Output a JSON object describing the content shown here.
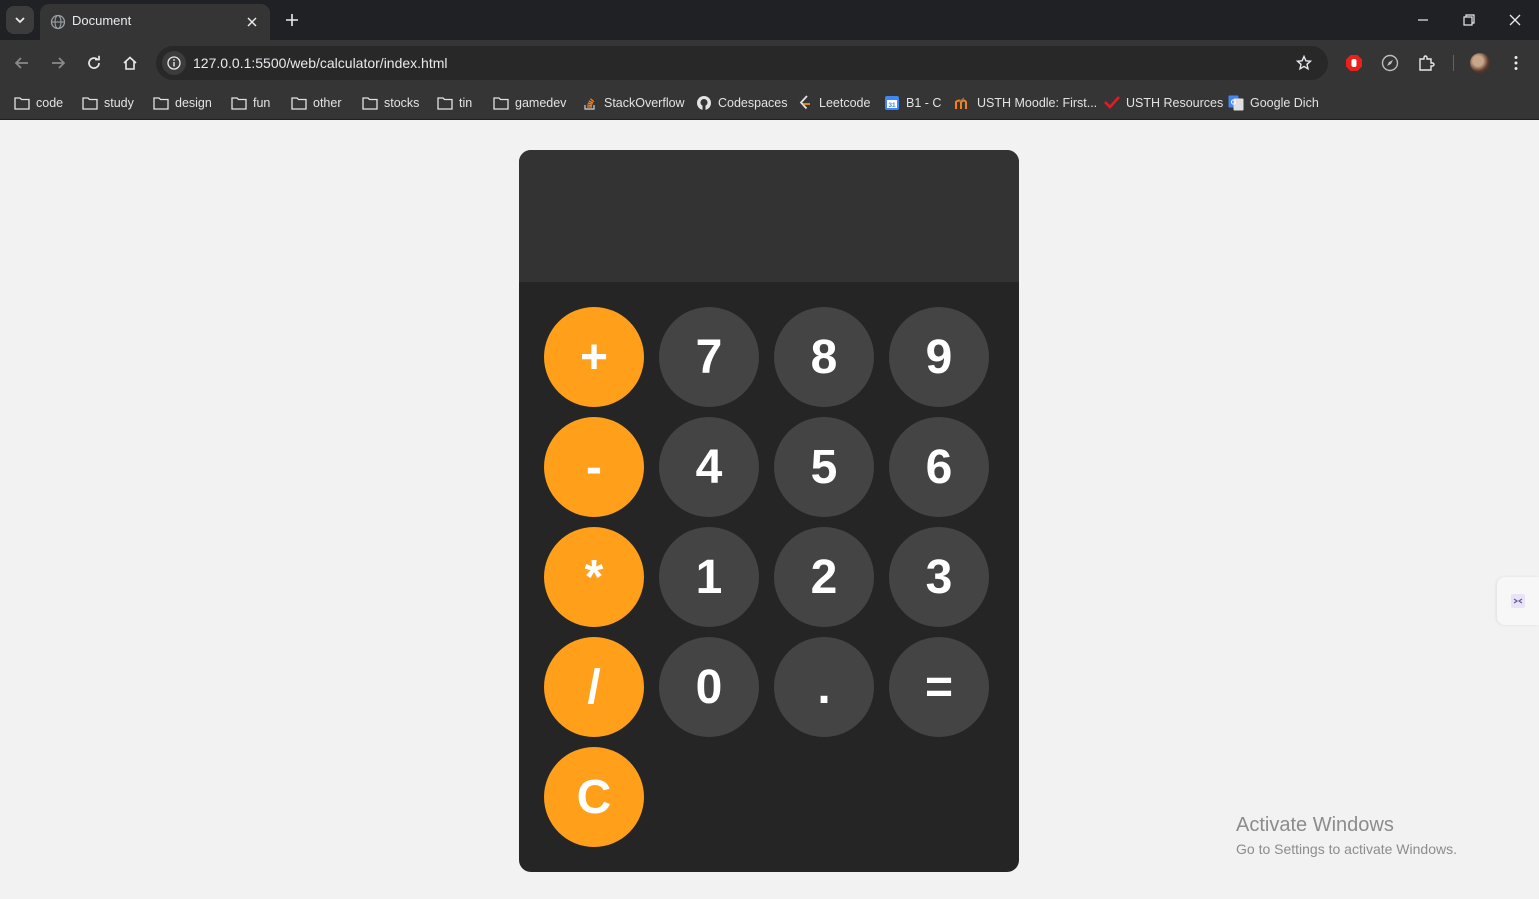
{
  "browser": {
    "tab_title": "Document",
    "url": "127.0.0.1:5500/web/calculator/index.html",
    "bookmarks": [
      {
        "label": "code",
        "icon": "folder-icon"
      },
      {
        "label": "study",
        "icon": "folder-icon"
      },
      {
        "label": "design",
        "icon": "folder-icon"
      },
      {
        "label": "fun",
        "icon": "folder-icon"
      },
      {
        "label": "other",
        "icon": "folder-icon"
      },
      {
        "label": "stocks",
        "icon": "folder-icon"
      },
      {
        "label": "tin",
        "icon": "folder-icon"
      },
      {
        "label": "gamedev",
        "icon": "folder-icon"
      },
      {
        "label": "StackOverflow",
        "icon": "stackoverflow-icon"
      },
      {
        "label": "Codespaces",
        "icon": "github-icon"
      },
      {
        "label": "Leetcode",
        "icon": "leetcode-icon"
      },
      {
        "label": "B1 - C",
        "icon": "calendar-icon"
      },
      {
        "label": "USTH Moodle: First...",
        "icon": "moodle-icon"
      },
      {
        "label": "USTH Resources",
        "icon": "check-icon"
      },
      {
        "label": "Google Dich",
        "icon": "google-translate-icon"
      }
    ]
  },
  "calculator": {
    "display": "",
    "keys": {
      "plus": "+",
      "seven": "7",
      "eight": "8",
      "nine": "9",
      "minus": "-",
      "four": "4",
      "five": "5",
      "six": "6",
      "multiply": "*",
      "one": "1",
      "two": "2",
      "three": "3",
      "divide": "/",
      "zero": "0",
      "dot": ".",
      "equals": "=",
      "clear": "C"
    },
    "colors": {
      "operator": "#ff9f1a",
      "number": "#444444",
      "body": "#252525",
      "display": "#333333"
    }
  },
  "watermark": {
    "title": "Activate Windows",
    "subtitle": "Go to Settings to activate Windows."
  }
}
